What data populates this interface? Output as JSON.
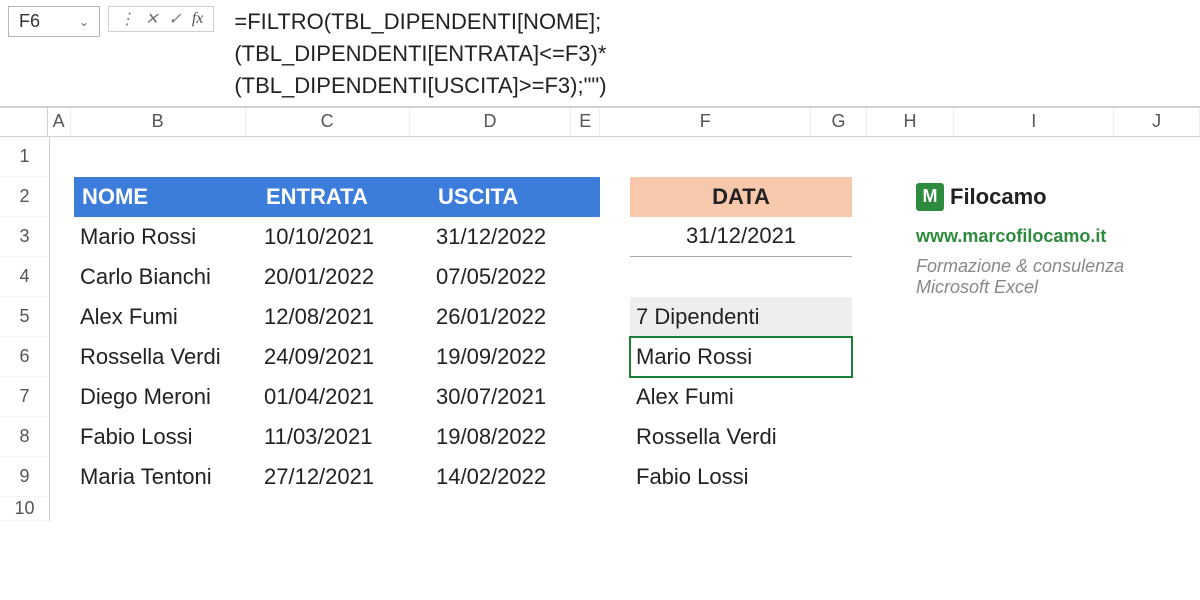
{
  "nameBox": "F6",
  "formulaLines": [
    "=FILTRO(TBL_DIPENDENTI[NOME];",
    "(TBL_DIPENDENTI[ENTRATA]<=F3)*",
    "(TBL_DIPENDENTI[USCITA]>=F3);\"\")"
  ],
  "columns": [
    "A",
    "B",
    "C",
    "D",
    "E",
    "F",
    "G",
    "H",
    "I",
    "J"
  ],
  "rowNumbers": [
    "1",
    "2",
    "3",
    "4",
    "5",
    "6",
    "7",
    "8",
    "9",
    "10"
  ],
  "tableHeaders": {
    "nome": "NOME",
    "entrata": "ENTRATA",
    "uscita": "USCITA"
  },
  "tableRows": [
    {
      "nome": "Mario Rossi",
      "entrata": "10/10/2021",
      "uscita": "31/12/2022"
    },
    {
      "nome": "Carlo Bianchi",
      "entrata": "20/01/2022",
      "uscita": "07/05/2022"
    },
    {
      "nome": "Alex Fumi",
      "entrata": "12/08/2021",
      "uscita": "26/01/2022"
    },
    {
      "nome": "Rossella Verdi",
      "entrata": "24/09/2021",
      "uscita": "19/09/2022"
    },
    {
      "nome": "Diego Meroni",
      "entrata": "01/04/2021",
      "uscita": "30/07/2021"
    },
    {
      "nome": "Fabio Lossi",
      "entrata": "11/03/2021",
      "uscita": "19/08/2022"
    },
    {
      "nome": "Maria Tentoni",
      "entrata": "27/12/2021",
      "uscita": "14/02/2022"
    }
  ],
  "dataHeader": "DATA",
  "dataValue": "31/12/2021",
  "countLabel": "7 Dipendenti",
  "filtered": [
    "Mario Rossi",
    "Alex Fumi",
    "Rossella Verdi",
    "Fabio Lossi"
  ],
  "logoText": "Filocamo",
  "url": "www.marcofilocamo.it",
  "tagline": "Formazione & consulenza Microsoft Excel"
}
